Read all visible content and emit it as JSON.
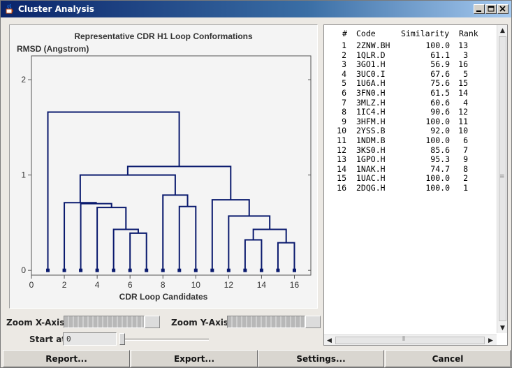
{
  "window": {
    "title": "Cluster Analysis"
  },
  "chart_data": {
    "type": "dendrogram",
    "title": "Representative CDR H1 Loop Conformations",
    "ylabel": "RMSD (Angstrom)",
    "xlabel": "CDR Loop Candidates",
    "xlim": [
      0,
      17
    ],
    "ylim": [
      -0.05,
      2.25
    ],
    "x_ticks": [
      "0",
      "2",
      "4",
      "6",
      "8",
      "10",
      "12",
      "14",
      "16"
    ],
    "y_ticks": [
      "0",
      "1",
      "2"
    ],
    "leaves": [
      1,
      2,
      3,
      4,
      5,
      6,
      7,
      8,
      9,
      10,
      11,
      12,
      13,
      14,
      15,
      16
    ],
    "merges": [
      {
        "left": 6,
        "right": 7,
        "height": 0.39
      },
      {
        "left": 5,
        "right": 6.5,
        "height": 0.43
      },
      {
        "left": 4,
        "right": 5.75,
        "height": 0.66
      },
      {
        "left": 3,
        "right": 4.875,
        "height": 0.7
      },
      {
        "left": 2,
        "right": 3.9375,
        "height": 0.71
      },
      {
        "left": 9,
        "right": 10,
        "height": 0.67
      },
      {
        "left": 8,
        "right": 9.5,
        "height": 0.79
      },
      {
        "left": 2.96875,
        "right": 8.75,
        "height": 1.0
      },
      {
        "left": 13,
        "right": 14,
        "height": 0.32
      },
      {
        "left": 15,
        "right": 16,
        "height": 0.29
      },
      {
        "left": 13.5,
        "right": 15.5,
        "height": 0.43
      },
      {
        "left": 12,
        "right": 14.5,
        "height": 0.57
      },
      {
        "left": 11,
        "right": 13.25,
        "height": 0.74
      },
      {
        "left": 5.859375,
        "right": 12.125,
        "height": 1.09
      },
      {
        "left": 1,
        "right": 8.9921875,
        "height": 1.66
      }
    ],
    "line_color": "#0a1a6e"
  },
  "table": {
    "headers": [
      "#",
      "Code",
      "Similarity",
      "Rank"
    ],
    "rows": [
      {
        "n": "1",
        "code": "2ZNW.BH",
        "similarity": "100.0",
        "rank": "13"
      },
      {
        "n": "2",
        "code": "1QLR.D",
        "similarity": "61.1",
        "rank": "3"
      },
      {
        "n": "3",
        "code": "3GO1.H",
        "similarity": "56.9",
        "rank": "16"
      },
      {
        "n": "4",
        "code": "3UC0.I",
        "similarity": "67.6",
        "rank": "5"
      },
      {
        "n": "5",
        "code": "1U6A.H",
        "similarity": "75.6",
        "rank": "15"
      },
      {
        "n": "6",
        "code": "3FN0.H",
        "similarity": "61.5",
        "rank": "14"
      },
      {
        "n": "7",
        "code": "3MLZ.H",
        "similarity": "60.6",
        "rank": "4"
      },
      {
        "n": "8",
        "code": "1IC4.H",
        "similarity": "90.6",
        "rank": "12"
      },
      {
        "n": "9",
        "code": "3HFM.H",
        "similarity": "100.0",
        "rank": "11"
      },
      {
        "n": "10",
        "code": "2YSS.B",
        "similarity": "92.0",
        "rank": "10"
      },
      {
        "n": "11",
        "code": "1NDM.B",
        "similarity": "100.0",
        "rank": "6"
      },
      {
        "n": "12",
        "code": "3KS0.H",
        "similarity": "85.6",
        "rank": "7"
      },
      {
        "n": "13",
        "code": "1GPO.H",
        "similarity": "95.3",
        "rank": "9"
      },
      {
        "n": "14",
        "code": "1NAK.H",
        "similarity": "74.7",
        "rank": "8"
      },
      {
        "n": "15",
        "code": "1UAC.H",
        "similarity": "100.0",
        "rank": "2"
      },
      {
        "n": "16",
        "code": "2DQG.H",
        "similarity": "100.0",
        "rank": "1"
      }
    ]
  },
  "controls": {
    "zoom_x_label": "Zoom X-Axis:",
    "zoom_y_label": "Zoom Y-Axis:",
    "start_at_label": "Start at:",
    "start_at_value": "0"
  },
  "buttons": {
    "report": "Report...",
    "export": "Export...",
    "settings": "Settings...",
    "cancel": "Cancel"
  },
  "icons": {
    "app": "java-cup-icon",
    "minimize": "minimize-icon",
    "maximize": "maximize-icon",
    "close": "close-icon"
  }
}
